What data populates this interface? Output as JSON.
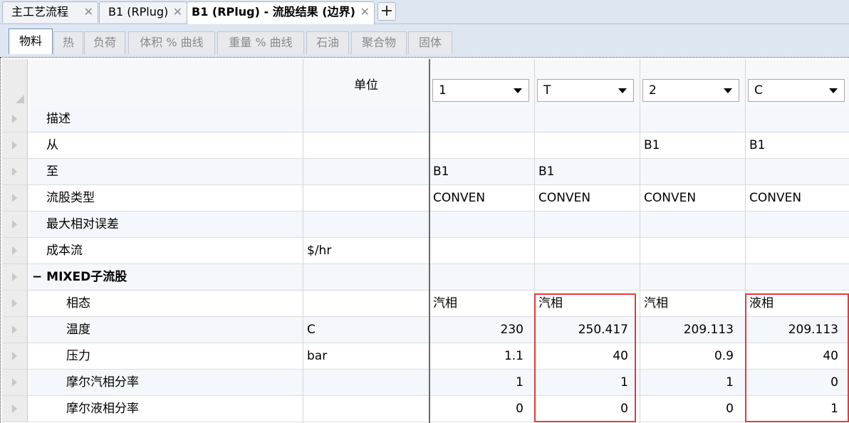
{
  "doc_tabs": [
    {
      "label": "主工艺流程",
      "close": "✕"
    },
    {
      "label": "B1 (RPlug)",
      "close": "✕"
    },
    {
      "label": "B1 (RPlug) - 流股结果 (边界)",
      "close": "✕"
    }
  ],
  "add_tab": "+",
  "sub_tabs": [
    "物料",
    "热",
    "负荷",
    "体积 % 曲线",
    "重量 % 曲线",
    "石油",
    "聚合物",
    "固体"
  ],
  "grid": {
    "unit_header": "单位",
    "streams": [
      "1",
      "T",
      "2",
      "C"
    ],
    "rows": [
      {
        "label": "描述",
        "unit": "",
        "values": [
          "",
          "",
          "",
          ""
        ]
      },
      {
        "label": "从",
        "unit": "",
        "values": [
          "",
          "",
          "B1",
          "B1"
        ]
      },
      {
        "label": "至",
        "unit": "",
        "values": [
          "B1",
          "B1",
          "",
          ""
        ]
      },
      {
        "label": "流股类型",
        "unit": "",
        "values": [
          "CONVEN",
          "CONVEN",
          "CONVEN",
          "CONVEN"
        ]
      },
      {
        "label": "最大相对误差",
        "unit": "",
        "values": [
          "",
          "",
          "",
          ""
        ]
      },
      {
        "label": "成本流",
        "unit": "$/hr",
        "values": [
          "",
          "",
          "",
          ""
        ]
      },
      {
        "label": "MIXED子流股",
        "toggle": "−",
        "unit": "",
        "values": [
          "",
          "",
          "",
          ""
        ]
      },
      {
        "label": "相态",
        "unit": "",
        "values": [
          "汽相",
          "汽相",
          "汽相",
          "液相"
        ]
      },
      {
        "label": "温度",
        "unit": "C",
        "values": [
          "230",
          "250.417",
          "209.113",
          "209.113"
        ]
      },
      {
        "label": "压力",
        "unit": "bar",
        "values": [
          "1.1",
          "40",
          "0.9",
          "40"
        ]
      },
      {
        "label": "摩尔汽相分率",
        "unit": "",
        "values": [
          "1",
          "1",
          "1",
          "0"
        ]
      },
      {
        "label": "摩尔液相分率",
        "unit": "",
        "values": [
          "0",
          "0",
          "0",
          "1"
        ]
      }
    ]
  },
  "colors": {
    "highlight": "#e23b3b",
    "tab_strip": "#dee6f2"
  }
}
